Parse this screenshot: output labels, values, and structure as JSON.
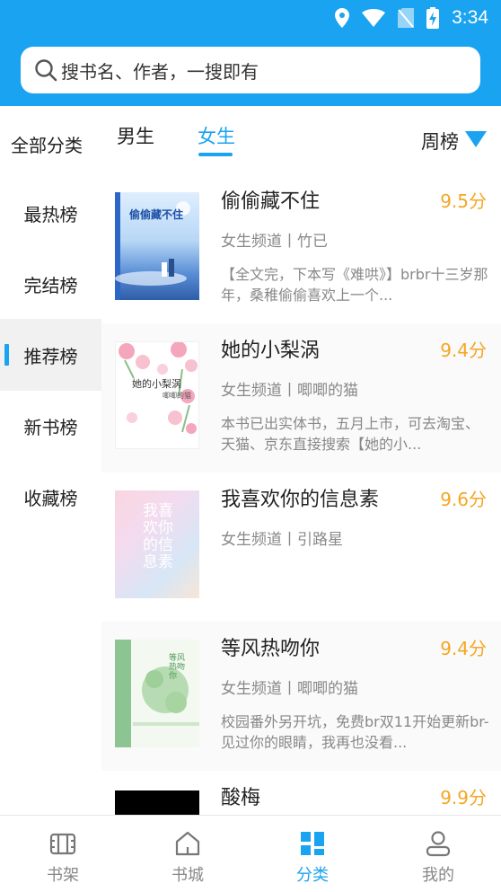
{
  "status": {
    "time": "3:34"
  },
  "search": {
    "placeholder": "搜书名、作者，一搜即有"
  },
  "top": {
    "all_categories": "全部分类",
    "tabs": [
      {
        "label": "男生"
      },
      {
        "label": "女生"
      }
    ],
    "sort": "周榜"
  },
  "sidebar": {
    "items": [
      {
        "label": "最热榜"
      },
      {
        "label": "完结榜"
      },
      {
        "label": "推荐榜"
      },
      {
        "label": "新书榜"
      },
      {
        "label": "收藏榜"
      }
    ]
  },
  "books": [
    {
      "title": "偷偷藏不住",
      "score": "9.5分",
      "meta": "女生频道丨竹已",
      "desc": "【全文完，下本写《难哄》】brbr十三岁那年，桑稚偷偷喜欢上一个...",
      "cover_text": "偷偷藏不住"
    },
    {
      "title": "她的小梨涡",
      "score": "9.4分",
      "meta": "女生频道丨唧唧的猫",
      "desc": "本书已出实体书，五月上市，可去淘宝、天猫、京东直接搜索【她的小...",
      "cover_text": "她的小梨涡",
      "cover_sub": "唧唧的猫"
    },
    {
      "title": "我喜欢你的信息素",
      "score": "9.6分",
      "meta": "女生频道丨引路星",
      "desc": "",
      "cover_text": "我喜欢你的信息素"
    },
    {
      "title": "等风热吻你",
      "score": "9.4分",
      "meta": "女生频道丨唧唧的猫",
      "desc": "校园番外另开坑，免费br双11开始更新br-见过你的眼睛，我再也没看...",
      "cover_text": "等风热吻你"
    },
    {
      "title": "酸梅",
      "score": "9.9分",
      "meta": "",
      "desc": ""
    }
  ],
  "nav": {
    "items": [
      {
        "label": "书架"
      },
      {
        "label": "书城"
      },
      {
        "label": "分类"
      },
      {
        "label": "我的"
      }
    ]
  },
  "colors": {
    "accent": "#1aa3f0",
    "score": "#f5a623"
  }
}
